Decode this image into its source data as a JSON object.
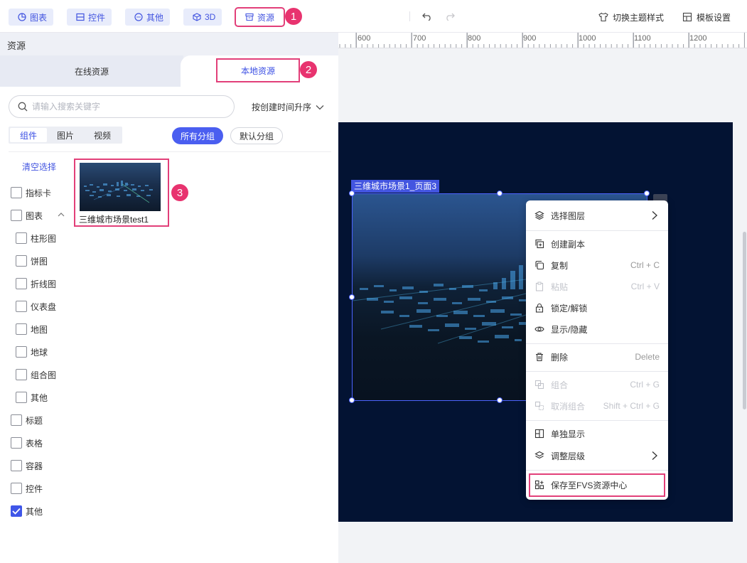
{
  "toolbar": {
    "buttons": [
      {
        "label": "图表",
        "icon": "chart-pie-icon"
      },
      {
        "label": "控件",
        "icon": "widget-icon"
      },
      {
        "label": "其他",
        "icon": "more-dots-icon"
      },
      {
        "label": "3D",
        "icon": "cube-icon"
      },
      {
        "label": "资源",
        "icon": "archive-icon"
      }
    ],
    "undo_icon": "undo-icon",
    "redo_icon": "redo-icon",
    "theme_label": "切换主题样式",
    "template_label": "模板设置"
  },
  "annotations": [
    "1",
    "2",
    "3"
  ],
  "left_panel": {
    "header": "资源",
    "tabs": {
      "online": "在线资源",
      "local": "本地资源"
    },
    "search_placeholder": "请输入搜索关键字",
    "sort_label": "按创建时间升序",
    "type_segments": [
      "组件",
      "图片",
      "视频"
    ],
    "group_pills": [
      "所有分组",
      "默认分组"
    ],
    "clear_label": "清空选择",
    "categories": [
      {
        "label": "指标卡",
        "checked": false
      },
      {
        "label": "图表",
        "checked": false,
        "expanded": true
      },
      {
        "label": "柱形图",
        "checked": false
      },
      {
        "label": "饼图",
        "checked": false
      },
      {
        "label": "折线图",
        "checked": false
      },
      {
        "label": "仪表盘",
        "checked": false
      },
      {
        "label": "地图",
        "checked": false
      },
      {
        "label": "地球",
        "checked": false
      },
      {
        "label": "组合图",
        "checked": false
      },
      {
        "label": "其他",
        "checked": false
      },
      {
        "label": "标题",
        "checked": false
      },
      {
        "label": "表格",
        "checked": false
      },
      {
        "label": "容器",
        "checked": false
      },
      {
        "label": "控件",
        "checked": false
      },
      {
        "label": "其他",
        "checked": true
      }
    ],
    "resource_card": {
      "title": "三维城市场景test1"
    }
  },
  "canvas": {
    "ruler_ticks": [
      "600",
      "700",
      "800",
      "900",
      "1000",
      "1100",
      "1200"
    ],
    "selection_label": "三维城市场景1_页面3"
  },
  "context_menu": {
    "items": [
      {
        "label": "选择图层",
        "shortcut": "",
        "submenu": true,
        "disabled": false,
        "icon": "layers-icon"
      },
      {
        "label": "创建副本",
        "shortcut": "",
        "submenu": false,
        "disabled": false,
        "icon": "duplicate-icon"
      },
      {
        "label": "复制",
        "shortcut": "Ctrl + C",
        "submenu": false,
        "disabled": false,
        "icon": "copy-icon"
      },
      {
        "label": "粘贴",
        "shortcut": "Ctrl + V",
        "submenu": false,
        "disabled": true,
        "icon": "paste-icon"
      },
      {
        "label": "锁定/解锁",
        "shortcut": "",
        "submenu": false,
        "disabled": false,
        "icon": "lock-icon"
      },
      {
        "label": "显示/隐藏",
        "shortcut": "",
        "submenu": false,
        "disabled": false,
        "icon": "eye-icon"
      },
      {
        "label": "删除",
        "shortcut": "Delete",
        "submenu": false,
        "disabled": false,
        "icon": "trash-icon"
      },
      {
        "label": "组合",
        "shortcut": "Ctrl + G",
        "submenu": false,
        "disabled": true,
        "icon": "group-icon"
      },
      {
        "label": "取消组合",
        "shortcut": "Shift + Ctrl + G",
        "submenu": false,
        "disabled": true,
        "icon": "ungroup-icon"
      },
      {
        "label": "单独显示",
        "shortcut": "",
        "submenu": false,
        "disabled": false,
        "icon": "solo-view-icon"
      },
      {
        "label": "调整层级",
        "shortcut": "",
        "submenu": true,
        "disabled": false,
        "icon": "stack-icon"
      },
      {
        "label": "保存至FVS资源中心",
        "shortcut": "",
        "submenu": false,
        "disabled": false,
        "icon": "grid-plus-icon"
      }
    ]
  },
  "colors": {
    "accent": "#4355e0",
    "highlight": "#e23f79",
    "badge": "#e8336f",
    "artboard": "#031333"
  }
}
